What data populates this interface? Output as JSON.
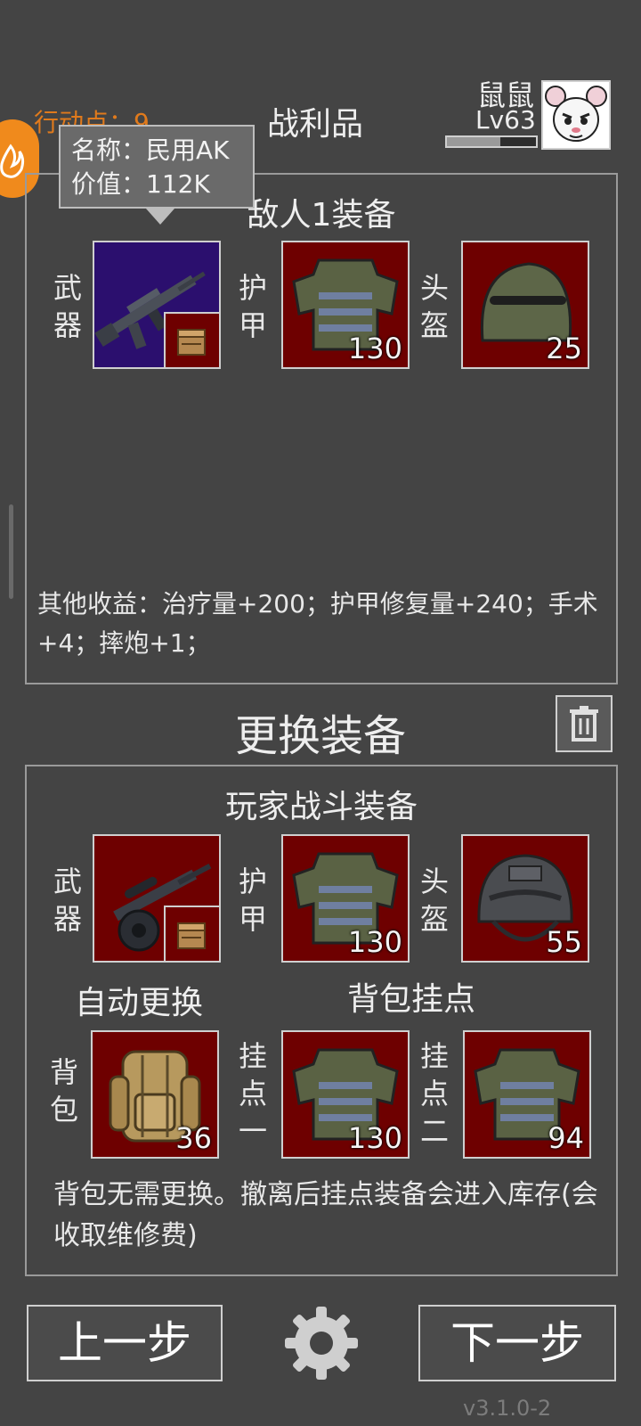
{
  "header": {
    "action_points": "行动点：9",
    "loot_title": "战利品",
    "player_name": "鼠鼠",
    "player_level": "Lv63"
  },
  "tooltip": {
    "name_line": "名称：民用AK",
    "value_line": "价值：112K"
  },
  "enemy": {
    "title": "敌人1装备",
    "weapon_label": "武器",
    "armor_label": "护甲",
    "armor_value": "130",
    "helmet_label": "头盔",
    "helmet_value": "25",
    "other_income": "其他收益：治疗量+200；护甲修复量+240；手术+4；摔炮+1；"
  },
  "swap_title": "更换装备",
  "player": {
    "title": "玩家战斗装备",
    "weapon_label": "武器",
    "armor_label": "护甲",
    "armor_value": "130",
    "helmet_label": "头盔",
    "helmet_value": "55",
    "auto_swap": "自动更换",
    "backpack_mount_title": "背包挂点",
    "backpack_label": "背包",
    "backpack_value": "36",
    "mount1_label": "挂点一",
    "mount1_value": "130",
    "mount2_label": "挂点二",
    "mount2_value": "94",
    "note": "背包无需更换。撤离后挂点装备会进入库存(会收取维修费)"
  },
  "buttons": {
    "prev": "上一步",
    "next": "下一步"
  },
  "version": "v3.1.0-2",
  "icons": [
    "fire-badge-icon",
    "rifle-icon",
    "ammo-box-icon",
    "vest-icon",
    "helmet-icon",
    "trash-icon",
    "gear-icon",
    "sniper-rifle-icon",
    "tactical-helmet-icon",
    "backpack-icon"
  ],
  "colors": {
    "background": "#444444",
    "slot_red": "#6e0000",
    "slot_purple": "#2b0f6e",
    "accent_orange": "#e07a1c"
  }
}
